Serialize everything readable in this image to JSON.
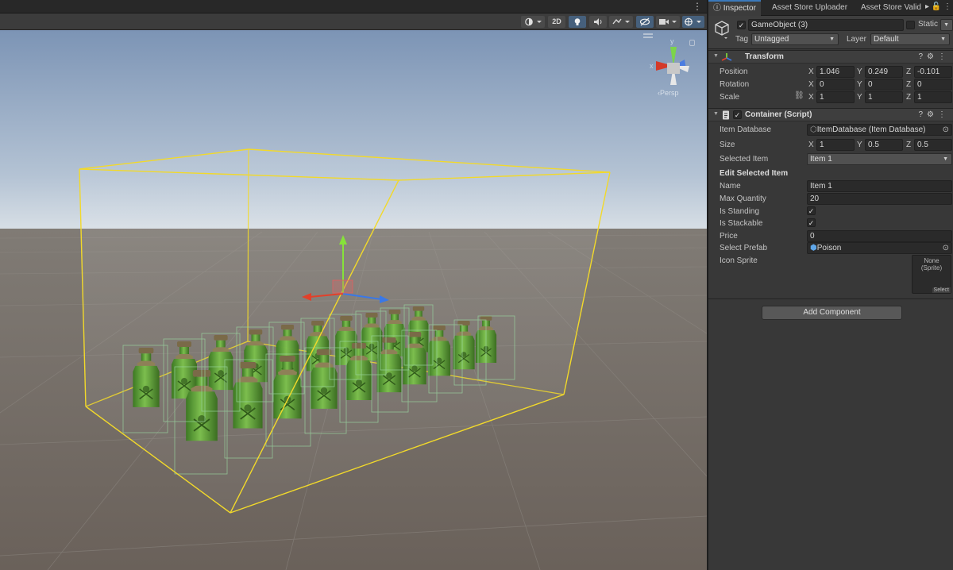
{
  "scene": {
    "toolbar": {
      "mode_2d": "2D"
    },
    "persp_label": "‹Persp",
    "gizmo_axes": {
      "y": "y",
      "x": "x"
    },
    "container_box_color": "#f2d92a",
    "bottle_color": "#5ea23a"
  },
  "inspector": {
    "tabs": [
      {
        "label": "Inspector",
        "active": true
      },
      {
        "label": "Asset Store Uploader",
        "active": false
      },
      {
        "label": "Asset Store Valid",
        "active": false
      }
    ],
    "game_object": {
      "active": true,
      "name": "GameObject (3)",
      "static_label": "Static",
      "static_checked": false,
      "tag_label": "Tag",
      "tag_value": "Untagged",
      "layer_label": "Layer",
      "layer_value": "Default"
    },
    "transform": {
      "title": "Transform",
      "position_label": "Position",
      "rotation_label": "Rotation",
      "scale_label": "Scale",
      "position": {
        "x": "1.046",
        "y": "0.249",
        "z": "-0.101"
      },
      "rotation": {
        "x": "0",
        "y": "0",
        "z": "0"
      },
      "scale": {
        "x": "1",
        "y": "1",
        "z": "1"
      },
      "axis_x": "X",
      "axis_y": "Y",
      "axis_z": "Z"
    },
    "container": {
      "title": "Container (Script)",
      "enabled": true,
      "item_database_label": "Item Database",
      "item_database_value": "ItemDatabase (Item Database)",
      "size_label": "Size",
      "size": {
        "x": "1",
        "y": "0.5",
        "z": "0.5"
      },
      "selected_item_label": "Selected Item",
      "selected_item_value": "Item 1",
      "edit_section": "Edit Selected Item",
      "name_label": "Name",
      "name_value": "Item 1",
      "max_quantity_label": "Max Quantity",
      "max_quantity_value": "20",
      "is_standing_label": "Is Standing",
      "is_standing": true,
      "is_stackable_label": "Is Stackable",
      "is_stackable": true,
      "price_label": "Price",
      "price_value": "0",
      "select_prefab_label": "Select Prefab",
      "select_prefab_value": "Poison",
      "icon_sprite_label": "Icon Sprite",
      "sprite_none": "None",
      "sprite_type": "(Sprite)",
      "sprite_select": "Select"
    },
    "add_component": "Add Component"
  }
}
